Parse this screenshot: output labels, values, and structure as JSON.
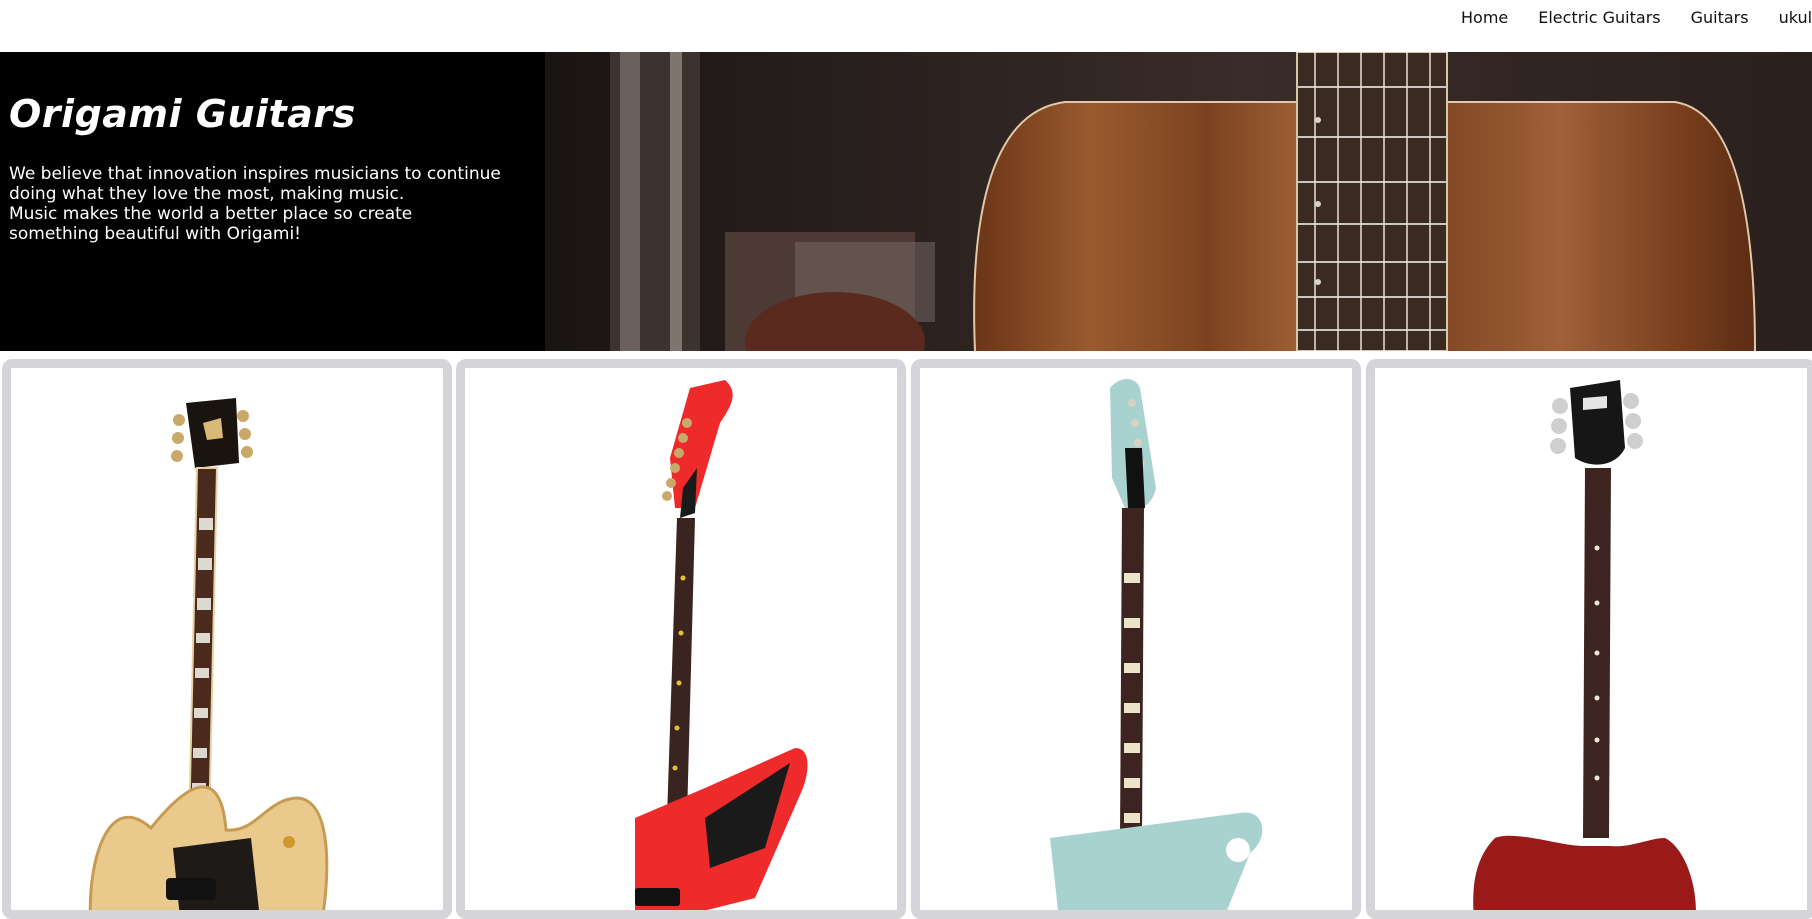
{
  "nav": {
    "links": [
      "Home",
      "Electric Guitars",
      "Guitars",
      "ukuleles"
    ]
  },
  "hero": {
    "title": "Origami Guitars",
    "description_lines": [
      "We believe that innovation inspires musicians to continue",
      "doing what they love the most, making music.",
      "Music makes the world a better place so create",
      "something beautiful with Origami!"
    ]
  },
  "colors": {
    "card_border": "#d5d5d9",
    "hero_background": "#000000",
    "nav_text": "#111111"
  },
  "products": [
    {
      "image": "natural-archtop-guitar-image",
      "body_color": "#e8c27a"
    },
    {
      "image": "red-explorer-guitar-image",
      "body_color": "#ee2a2a"
    },
    {
      "image": "seafoam-firebird-guitar-image",
      "body_color": "#a8d2cf"
    },
    {
      "image": "cherry-sg-guitar-image",
      "body_color": "#9a1a1a"
    }
  ]
}
